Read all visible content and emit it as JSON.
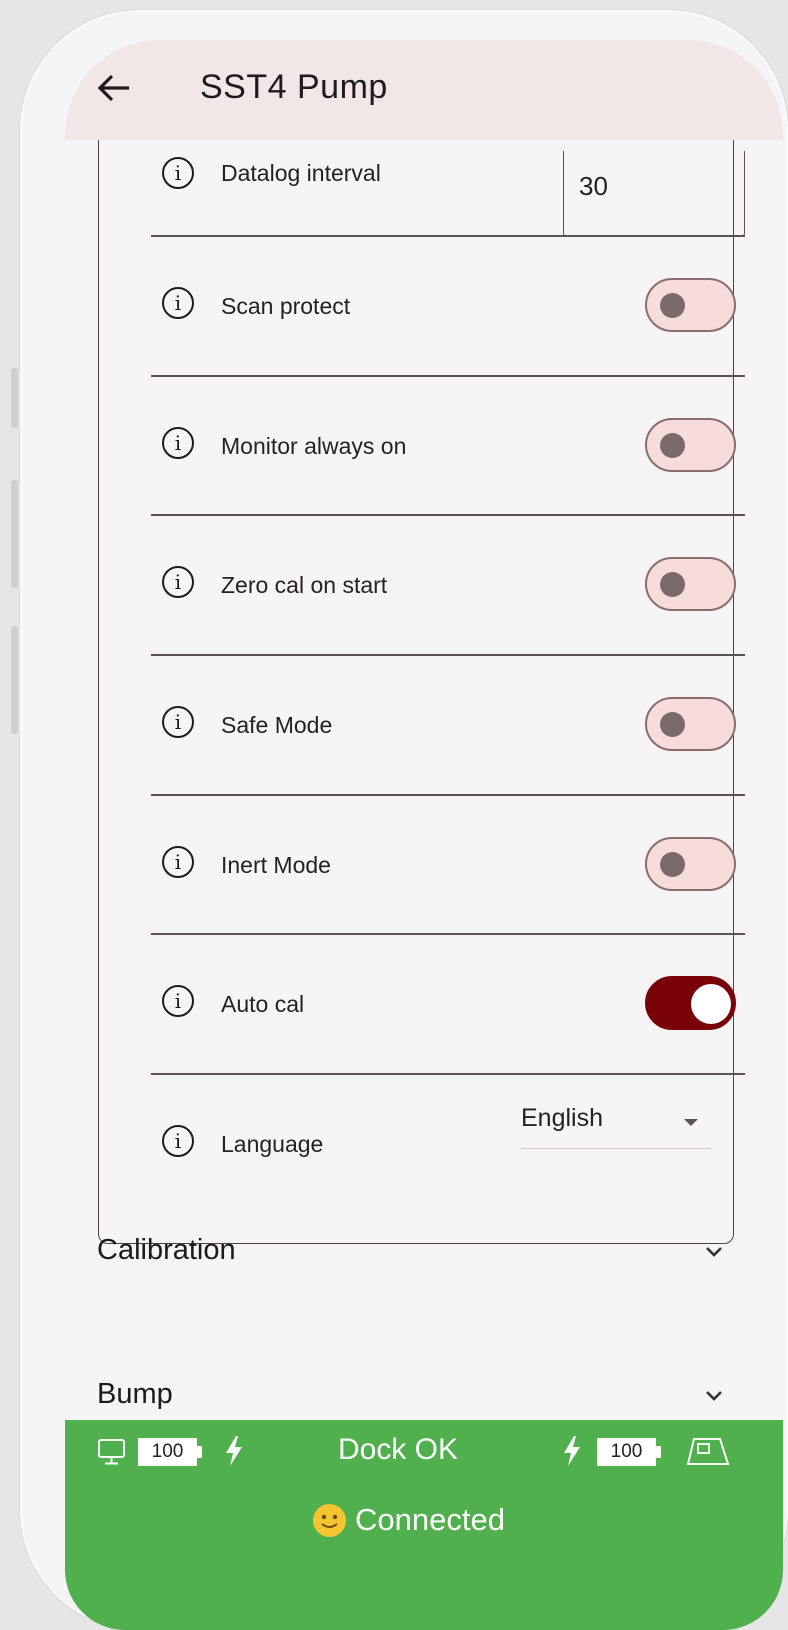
{
  "app": {
    "title": "SST4 Pump"
  },
  "settings": {
    "datalog": {
      "label": "Datalog interval",
      "value": "30"
    },
    "toggles": [
      {
        "label": "Scan protect",
        "on": false
      },
      {
        "label": "Monitor always on",
        "on": false
      },
      {
        "label": "Zero cal on start",
        "on": false
      },
      {
        "label": "Safe Mode",
        "on": false
      },
      {
        "label": "Inert Mode",
        "on": false
      },
      {
        "label": "Auto cal",
        "on": true
      }
    ],
    "language": {
      "label": "Language",
      "value": "English"
    }
  },
  "sections": [
    {
      "title": "Calibration"
    },
    {
      "title": "Bump"
    }
  ],
  "status": {
    "left_battery": "100",
    "dock": "Dock OK",
    "right_battery": "100",
    "connection": "Connected"
  },
  "colors": {
    "accent": "#780408",
    "status_bar": "#50b04e",
    "appbar": "#f2e7e6",
    "toggle_off_bg": "#f6dcda"
  },
  "icons": [
    "back-arrow-icon",
    "info-icon",
    "chevron-down-icon",
    "monitor-icon",
    "bolt-icon",
    "battery-icon",
    "device-icon",
    "smiley-icon"
  ]
}
